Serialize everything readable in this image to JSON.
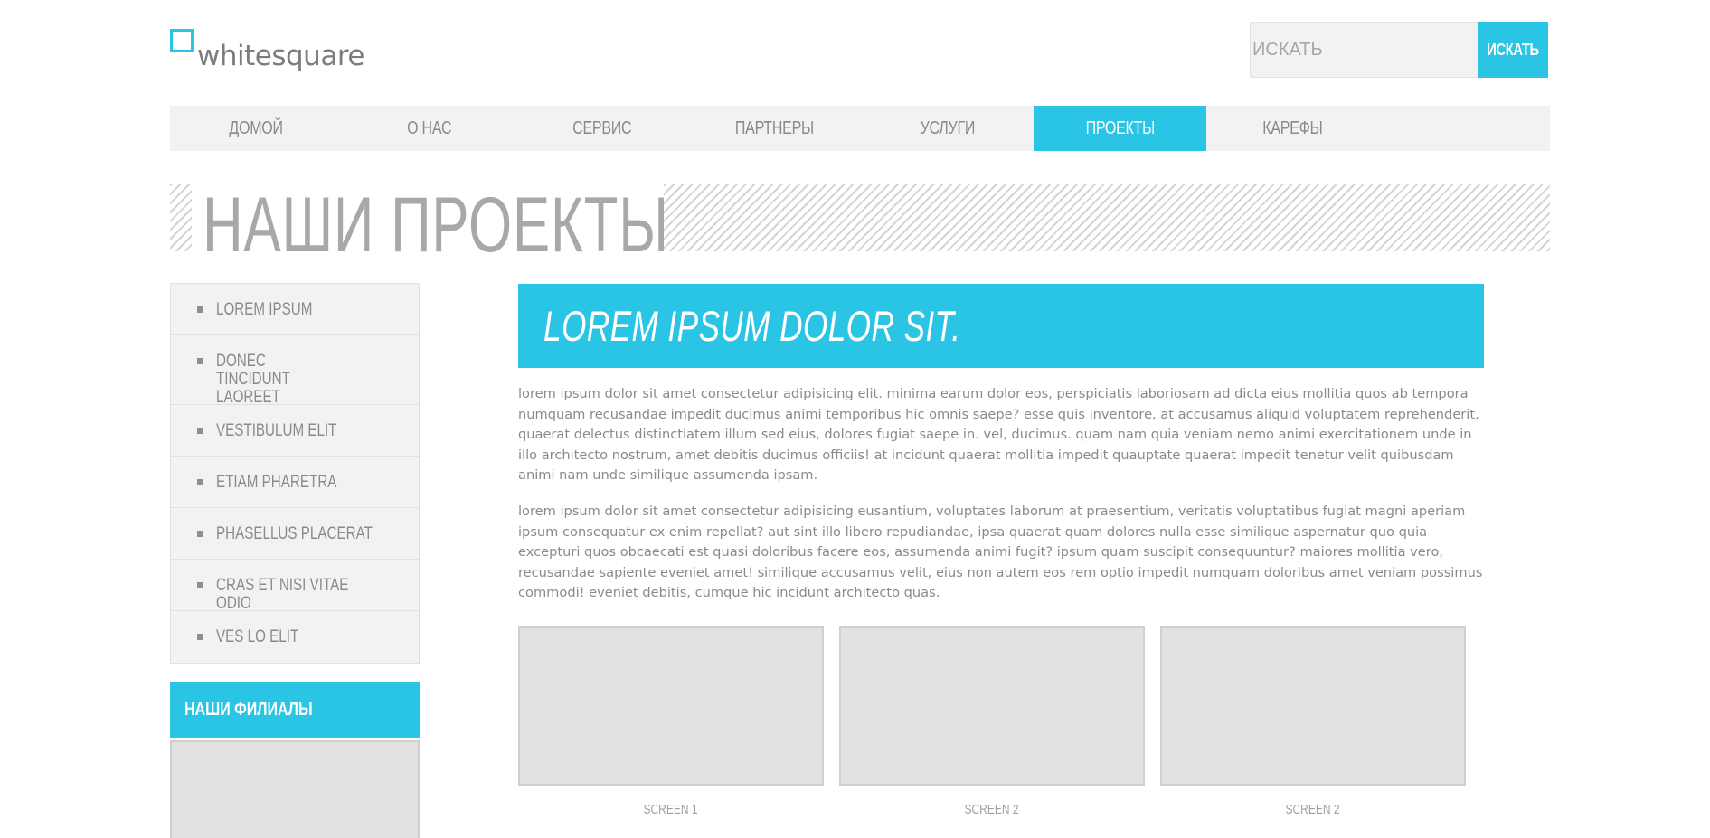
{
  "logo": {
    "text": "whitesquare"
  },
  "search": {
    "placeholder": "ИСКАТЬ",
    "button_label": "ИСКАТЬ"
  },
  "nav": {
    "items": [
      {
        "label": "ДОМОЙ",
        "active": false
      },
      {
        "label": "О НАС",
        "active": false
      },
      {
        "label": "СЕРВИС",
        "active": false
      },
      {
        "label": "ПАРТНЕРЫ",
        "active": false
      },
      {
        "label": "УСЛУГИ",
        "active": false
      },
      {
        "label": "ПРОЕКТЫ",
        "active": true
      },
      {
        "label": "КАРЕФЫ",
        "active": false
      }
    ]
  },
  "page": {
    "title": "НАШИ ПРОЕКТЫ"
  },
  "sidebar": {
    "items": [
      {
        "label": "LOREM IPSUM"
      },
      {
        "label": "DONEC TINCIDUNT LAOREET"
      },
      {
        "label": "VESTIBULUM ELIT"
      },
      {
        "label": "ETIAM PHARETRA"
      },
      {
        "label": "PHASELLUS PLACERAT"
      },
      {
        "label": "CRAS ET NISI VITAE ODIO"
      },
      {
        "label": "VES LO ELIT"
      }
    ],
    "branches_title": "НАШИ ФИЛИАЛЫ"
  },
  "main": {
    "banner": "LOREM IPSUM DOLOR SIT.",
    "paragraphs": [
      "lorem ipsum dolor sit amet consectetur adipisicing elit. minima earum dolor eos, perspiciatis laboriosam ad dicta eius mollitia quos ab tempora numquam recusandae impedit ducimus animi temporibus hic omnis saepe? esse quis inventore, at accusamus aliquid voluptatem reprehenderit, quaerat delectus distinctiatem illum sed eius, dolores fugiat saepe in. vel, ducimus. quam nam quia veniam nemo animi exercitationem unde in illo architecto nostrum, amet debitis ducimus officiis! at incidunt quaerat mollitia impedit quauptate quaerat impedit tenetur velit quibusdam animi nam unde similique assumenda ipsam.",
      "lorem ipsum dolor sit amet consectetur adipisicing eusantium, voluptates laborum at praesentium, veritatis voluptatibus fugiat magni aperiam ipsum consequatur ex enim repellat? aut sint illo libero repudiandae, ipsa quaerat quam dolores nulla esse similique aspernatur quo quia excepturi quos obcaecati est quasi doloribus facere eos, assumenda animi fugit? ipsum quam suscipit consequuntur? maiores mollitia vero, recusandae sapiente eveniet amet! similique accusamus velit, eius non autem eos rem optio impedit numquam doloribus amet veniam possimus commodi! eveniet debitis, cumque hic incidunt architecto quas."
    ],
    "screens": [
      {
        "caption": "SCREEN 1"
      },
      {
        "caption": "SCREEN 2"
      },
      {
        "caption": "SCREEN 2"
      }
    ]
  },
  "colors": {
    "accent": "#2ac4e4",
    "panel": "#f2f2f2",
    "placeholder_box": "#e1e1e1",
    "text": "#8a8a8a"
  }
}
